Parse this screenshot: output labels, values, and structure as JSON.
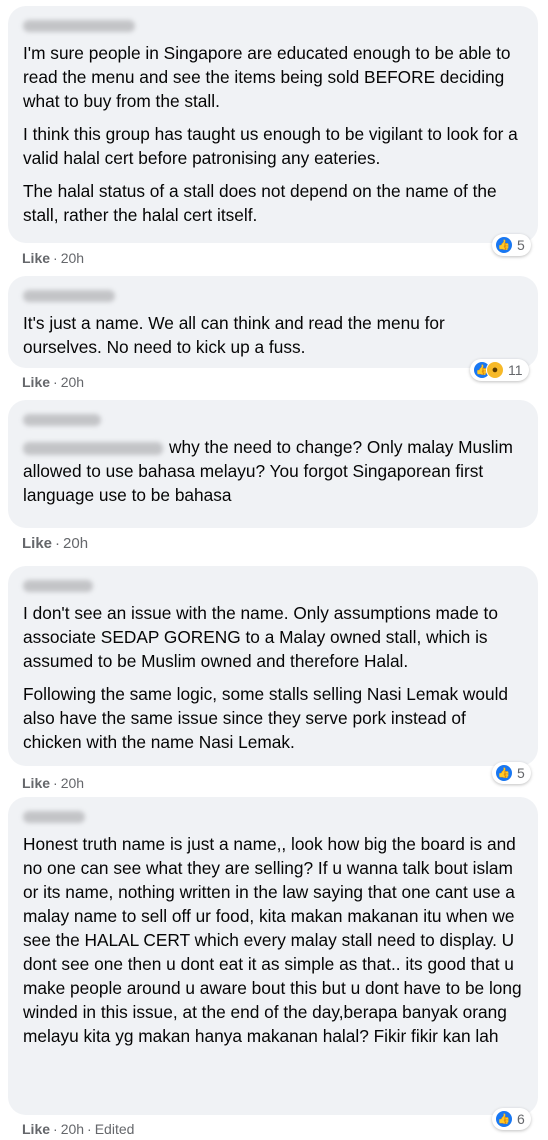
{
  "comments": [
    {
      "paragraphs": [
        "I'm sure people in Singapore are educated enough to be able to read the menu and see the items being sold BEFORE deciding what to buy from the stall.",
        "I think this group has taught us enough to be vigilant to look for a valid halal cert before patronising any eateries.",
        "The halal status of a stall does not depend on the name of the stall, rather the halal cert itself."
      ],
      "like_label": "Like",
      "time": "20h",
      "reactions": {
        "icons": [
          "like-icon"
        ],
        "count": "5"
      }
    },
    {
      "paragraphs": [
        "It's just a name. We all can think and read the menu for ourselves. No need to kick up a fuss."
      ],
      "like_label": "Like",
      "time": "20h",
      "reactions": {
        "icons": [
          "like-icon",
          "wow-icon"
        ],
        "count": "11"
      }
    },
    {
      "paragraphs": [
        "why the need to change? Only malay Muslim allowed to use bahasa melayu? You forgot Singaporean first language use to be bahasa"
      ],
      "like_label": "Like",
      "time": "20h"
    },
    {
      "paragraphs": [
        "I don't see an issue with the name. Only assumptions made to associate SEDAP GORENG to a Malay owned stall, which is assumed to be Muslim owned and therefore Halal.",
        "Following the same logic, some stalls selling Nasi Lemak would also have the same issue since they serve pork instead of chicken with the name Nasi Lemak."
      ],
      "like_label": "Like",
      "time": "20h",
      "reactions": {
        "icons": [
          "like-icon"
        ],
        "count": "5"
      }
    },
    {
      "paragraphs": [
        "Honest truth name is just a name,, look how big the board is and no one can see what they are selling? If u wanna talk bout islam or its name, nothing written in the law saying that one cant use a malay name to sell off ur food, kita makan makanan itu when we see the HALAL CERT which every malay stall need to display. U dont see one then u dont eat it as simple as that.. its good that u make people around u aware bout this but u dont have to be long winded in this issue, at the end of the day,berapa banyak orang melayu kita yg makan hanya makanan halal? Fikir fikir kan lah"
      ],
      "like_label": "Like",
      "time": "20h",
      "edited": "Edited",
      "reactions": {
        "icons": [
          "like-icon"
        ],
        "count": "6"
      }
    }
  ],
  "colors": {
    "bubble": "#f0f2f5",
    "like_blue": "#1877f2",
    "wow_yellow": "#f7b928",
    "meta_gray": "#65676b"
  }
}
